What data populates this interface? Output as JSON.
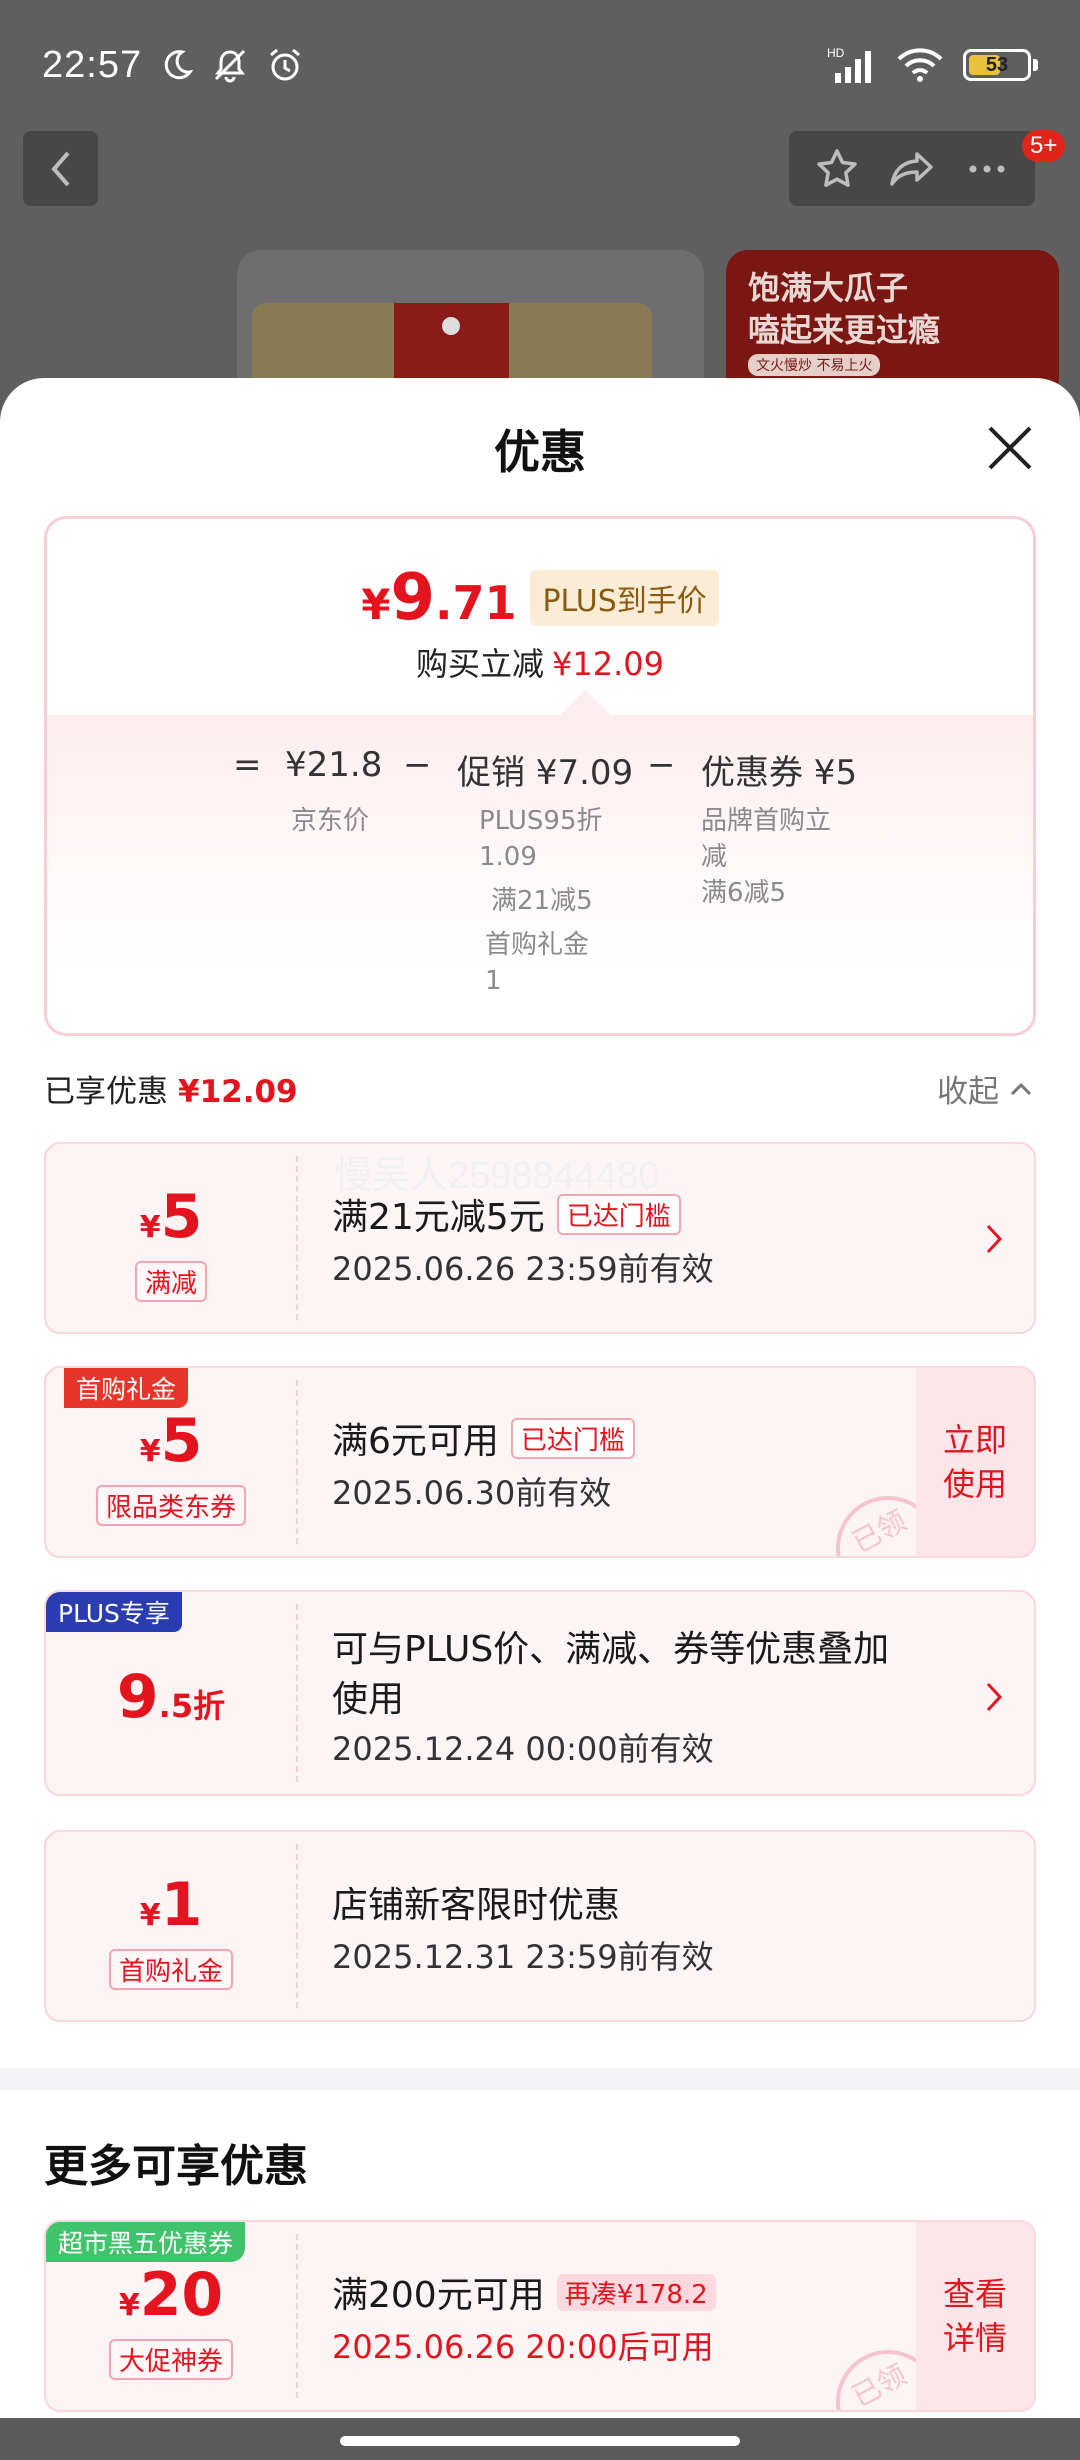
{
  "status": {
    "time": "22:57",
    "battery": "53",
    "signal": "HD"
  },
  "topbar": {
    "badge": "5+"
  },
  "background": {
    "banner_line1": "饱满大瓜子",
    "banner_line2": "嗑起来更过瘾",
    "banner_line3": "文火慢炒 不易上火"
  },
  "sheet": {
    "title": "优惠"
  },
  "summary": {
    "yen": "¥",
    "price_int": "9",
    "price_dec": ".71",
    "plus_tag": "PLUS到手价",
    "instant_label": "购买立减",
    "instant_value": "¥12.09",
    "eq": "=",
    "jd_price": "¥21.8",
    "minus1": "−",
    "promo": "促销 ¥7.09",
    "minus2": "−",
    "coupon": "优惠券 ¥5",
    "jd_label": "京东价",
    "promo_detail1": "PLUS95折",
    "promo_detail2": "1.09",
    "promo_detail3": "满21减5",
    "promo_detail4": "首购礼金",
    "promo_detail5": "1",
    "coupon_detail1": "品牌首购立",
    "coupon_detail2": "减",
    "coupon_detail3": "满6减5"
  },
  "enjoyed": {
    "label": "已享优惠",
    "value": "¥12.09",
    "collapse": "收起"
  },
  "watermark": "慢吴人2598844480",
  "coupons": [
    {
      "yen": "¥",
      "amount": "5",
      "tag": "满减",
      "title": "满21元减5元",
      "status": "已达门槛",
      "date": "2025.06.26 23:59前有效"
    },
    {
      "corner": "首购礼金",
      "yen": "¥",
      "amount": "5",
      "tag": "限品类东券",
      "title": "满6元可用",
      "status": "已达门槛",
      "date": "2025.06.30前有效",
      "action": "立即使用",
      "stamp": "已领"
    },
    {
      "corner": "PLUS专享",
      "amount": "9",
      "amount_suffix": ".5折",
      "title_l1": "可与PLUS价、满减、券等优惠叠加",
      "title_l2": "使用",
      "date": "2025.12.24 00:00前有效"
    },
    {
      "yen": "¥",
      "amount": "1",
      "tag": "首购礼金",
      "title": "店铺新客限时优惠",
      "date": "2025.12.31 23:59前有效"
    }
  ],
  "more": {
    "title": "更多可享优惠",
    "coupon": {
      "corner": "超市黑五优惠券",
      "yen": "¥",
      "amount": "20",
      "tag": "大促神券",
      "title": "满200元可用",
      "need": "再凑¥178.2",
      "date": "2025.06.26 20:00后可用",
      "action": "查看详情",
      "stamp": "已领"
    }
  },
  "colors": {
    "accent": "#e4141f",
    "plus_blue": "#2b3bb0",
    "gift_red": "#e8352b",
    "bf_green": "#3fc36b"
  }
}
